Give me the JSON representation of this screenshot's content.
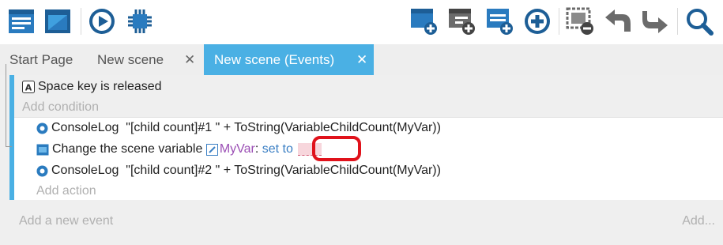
{
  "toolbar": {
    "left_icons": [
      "project-manager-icon",
      "scene-editor-icon",
      "preview-play-icon",
      "debugger-chip-icon"
    ],
    "right_icons": [
      "add-event-icon",
      "add-subevent-icon",
      "add-other-icon",
      "add-plus-icon",
      "delete-icon",
      "undo-icon",
      "redo-icon",
      "search-icon"
    ]
  },
  "tabs": [
    {
      "label": "Start Page",
      "closable": false,
      "active": false
    },
    {
      "label": "New scene",
      "closable": true,
      "active": false,
      "close": "✕"
    },
    {
      "label": "New scene (Events)",
      "closable": true,
      "active": true,
      "close": "✕"
    }
  ],
  "event": {
    "condition": {
      "key": "Space",
      "text": "key is released"
    },
    "add_condition": "Add condition",
    "actions": [
      {
        "name": "ConsoleLog",
        "args": "\"[child count]#1 \" + ToString(VariableChildCount(MyVar))"
      },
      {
        "name": "Change the scene variable",
        "variable": "MyVar",
        "separator": ":",
        "op": "set to"
      },
      {
        "name": "ConsoleLog",
        "args": "\"[child count]#2 \" + ToString(VariableChildCount(MyVar))"
      }
    ],
    "add_action": "Add action"
  },
  "footer": {
    "add_event": "Add a new event",
    "add_more": "Add..."
  },
  "colors": {
    "accent": "#4ab0e4",
    "highlight": "#e0121b",
    "variable": "#9b4fb5",
    "operator": "#3b7fc4"
  }
}
